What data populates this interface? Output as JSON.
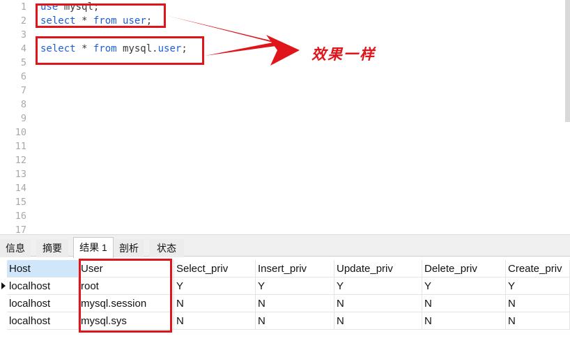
{
  "editor": {
    "line_numbers": [
      "1",
      "2",
      "3",
      "4",
      "5",
      "6",
      "7",
      "8",
      "9",
      "10",
      "11",
      "12",
      "13",
      "14",
      "15",
      "16",
      "17"
    ],
    "lines": {
      "l1": {
        "kw1": "use",
        "rest": " mysql;"
      },
      "l2": {
        "kw1": "select",
        "mid": " * ",
        "kw2": "from",
        "sp": " ",
        "tbl": "user",
        "end": ";"
      },
      "l4": {
        "kw1": "select",
        "mid": " * ",
        "kw2": "from",
        "db": " mysql.",
        "tbl": "user",
        "end": ";"
      }
    }
  },
  "annotation": {
    "text": "效果一样",
    "color": "#e0151b"
  },
  "tabs": [
    "信息",
    "摘要",
    "结果 1",
    "剖析",
    "状态"
  ],
  "active_tab": "结果 1",
  "table": {
    "columns": [
      "Host",
      "User",
      "Select_priv",
      "Insert_priv",
      "Update_priv",
      "Delete_priv",
      "Create_priv"
    ],
    "rows": [
      [
        "localhost",
        "root",
        "Y",
        "Y",
        "Y",
        "Y",
        "Y"
      ],
      [
        "localhost",
        "mysql.session",
        "N",
        "N",
        "N",
        "N",
        "N"
      ],
      [
        "localhost",
        "mysql.sys",
        "N",
        "N",
        "N",
        "N",
        "N"
      ]
    ]
  },
  "colors": {
    "keyword": "#1f5fd6",
    "highlight": "#e0151b",
    "selected_header": "#cfe6fb"
  }
}
